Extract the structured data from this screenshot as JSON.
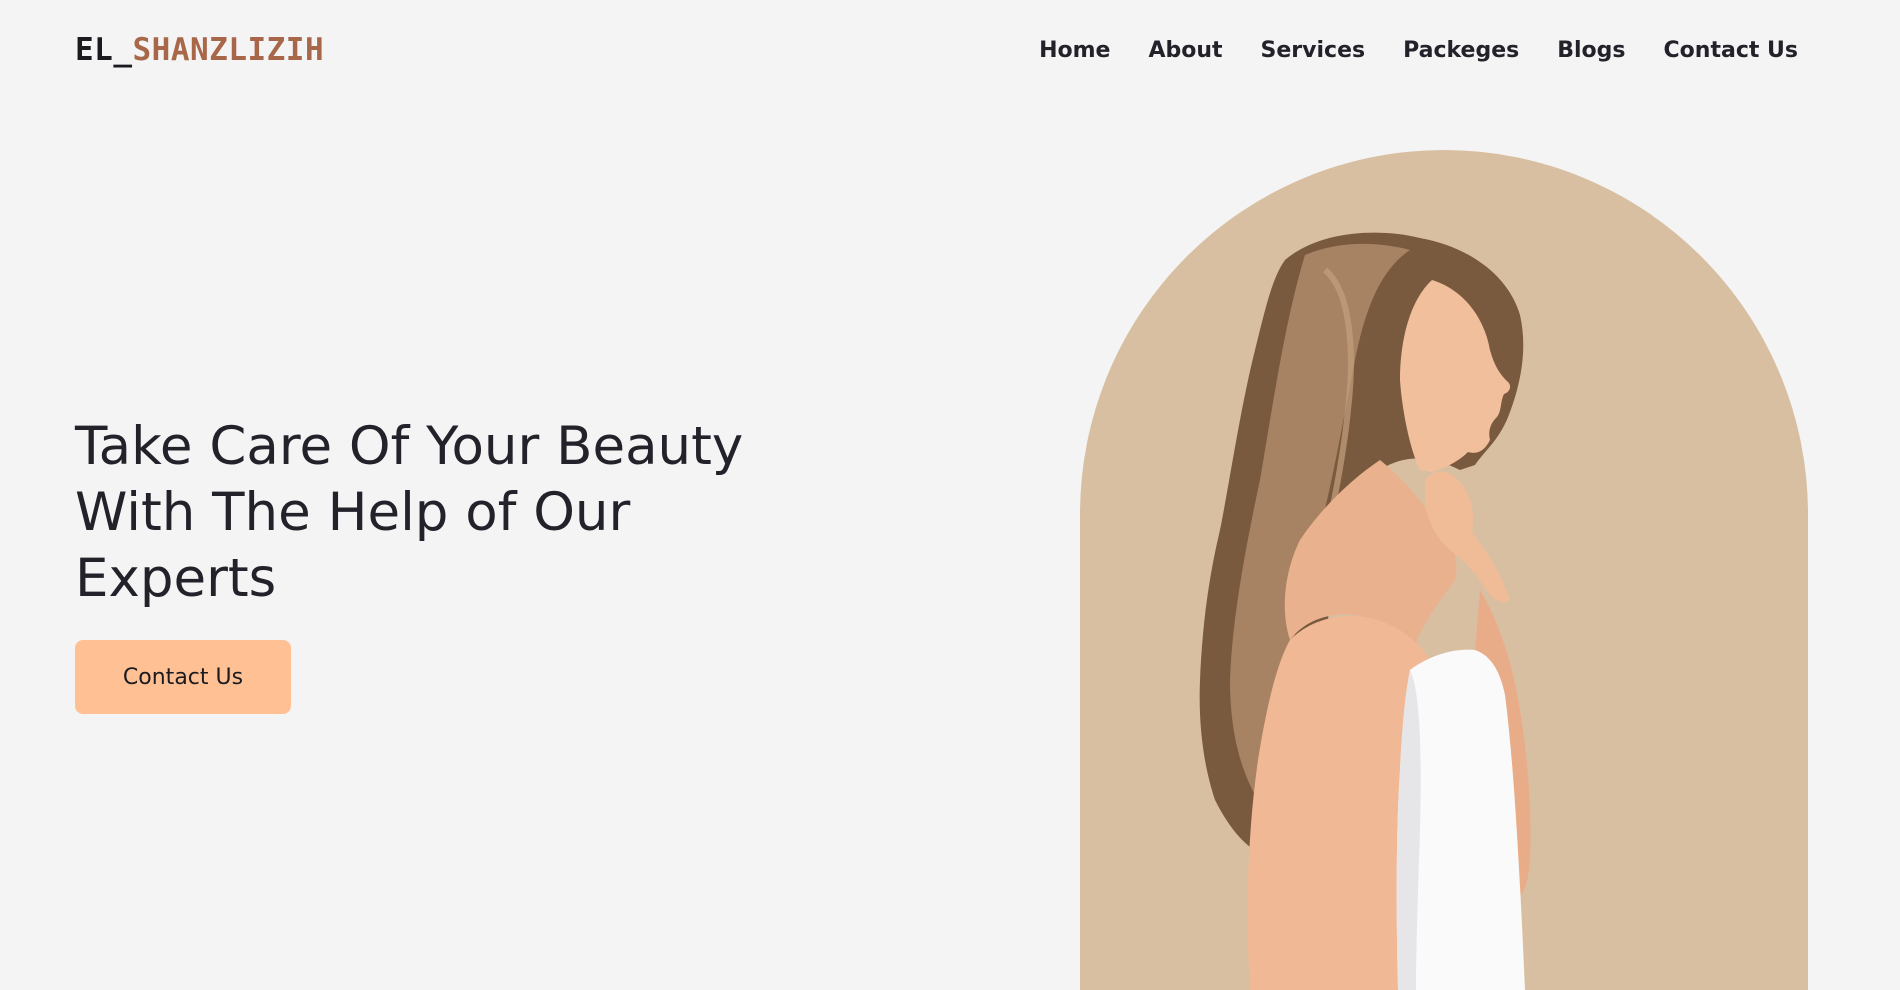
{
  "header": {
    "logo": {
      "part1": "EL_",
      "part2": "SHANZLIZIH"
    },
    "nav": [
      {
        "label": "Home"
      },
      {
        "label": "About"
      },
      {
        "label": "Services"
      },
      {
        "label": "Packeges"
      },
      {
        "label": "Blogs"
      },
      {
        "label": "Contact Us"
      }
    ]
  },
  "hero": {
    "title_lines": [
      "Take Care Of Your Beauty",
      "With The Help of Our",
      "Experts"
    ],
    "cta_label": "Contact Us",
    "image_icon": "woman-portrait-image"
  },
  "colors": {
    "background": "#f4f4f4",
    "text": "#23222b",
    "logo_accent": "#a9674a",
    "cta_background": "#ffc094",
    "arch_background": "#d9bfa2"
  }
}
